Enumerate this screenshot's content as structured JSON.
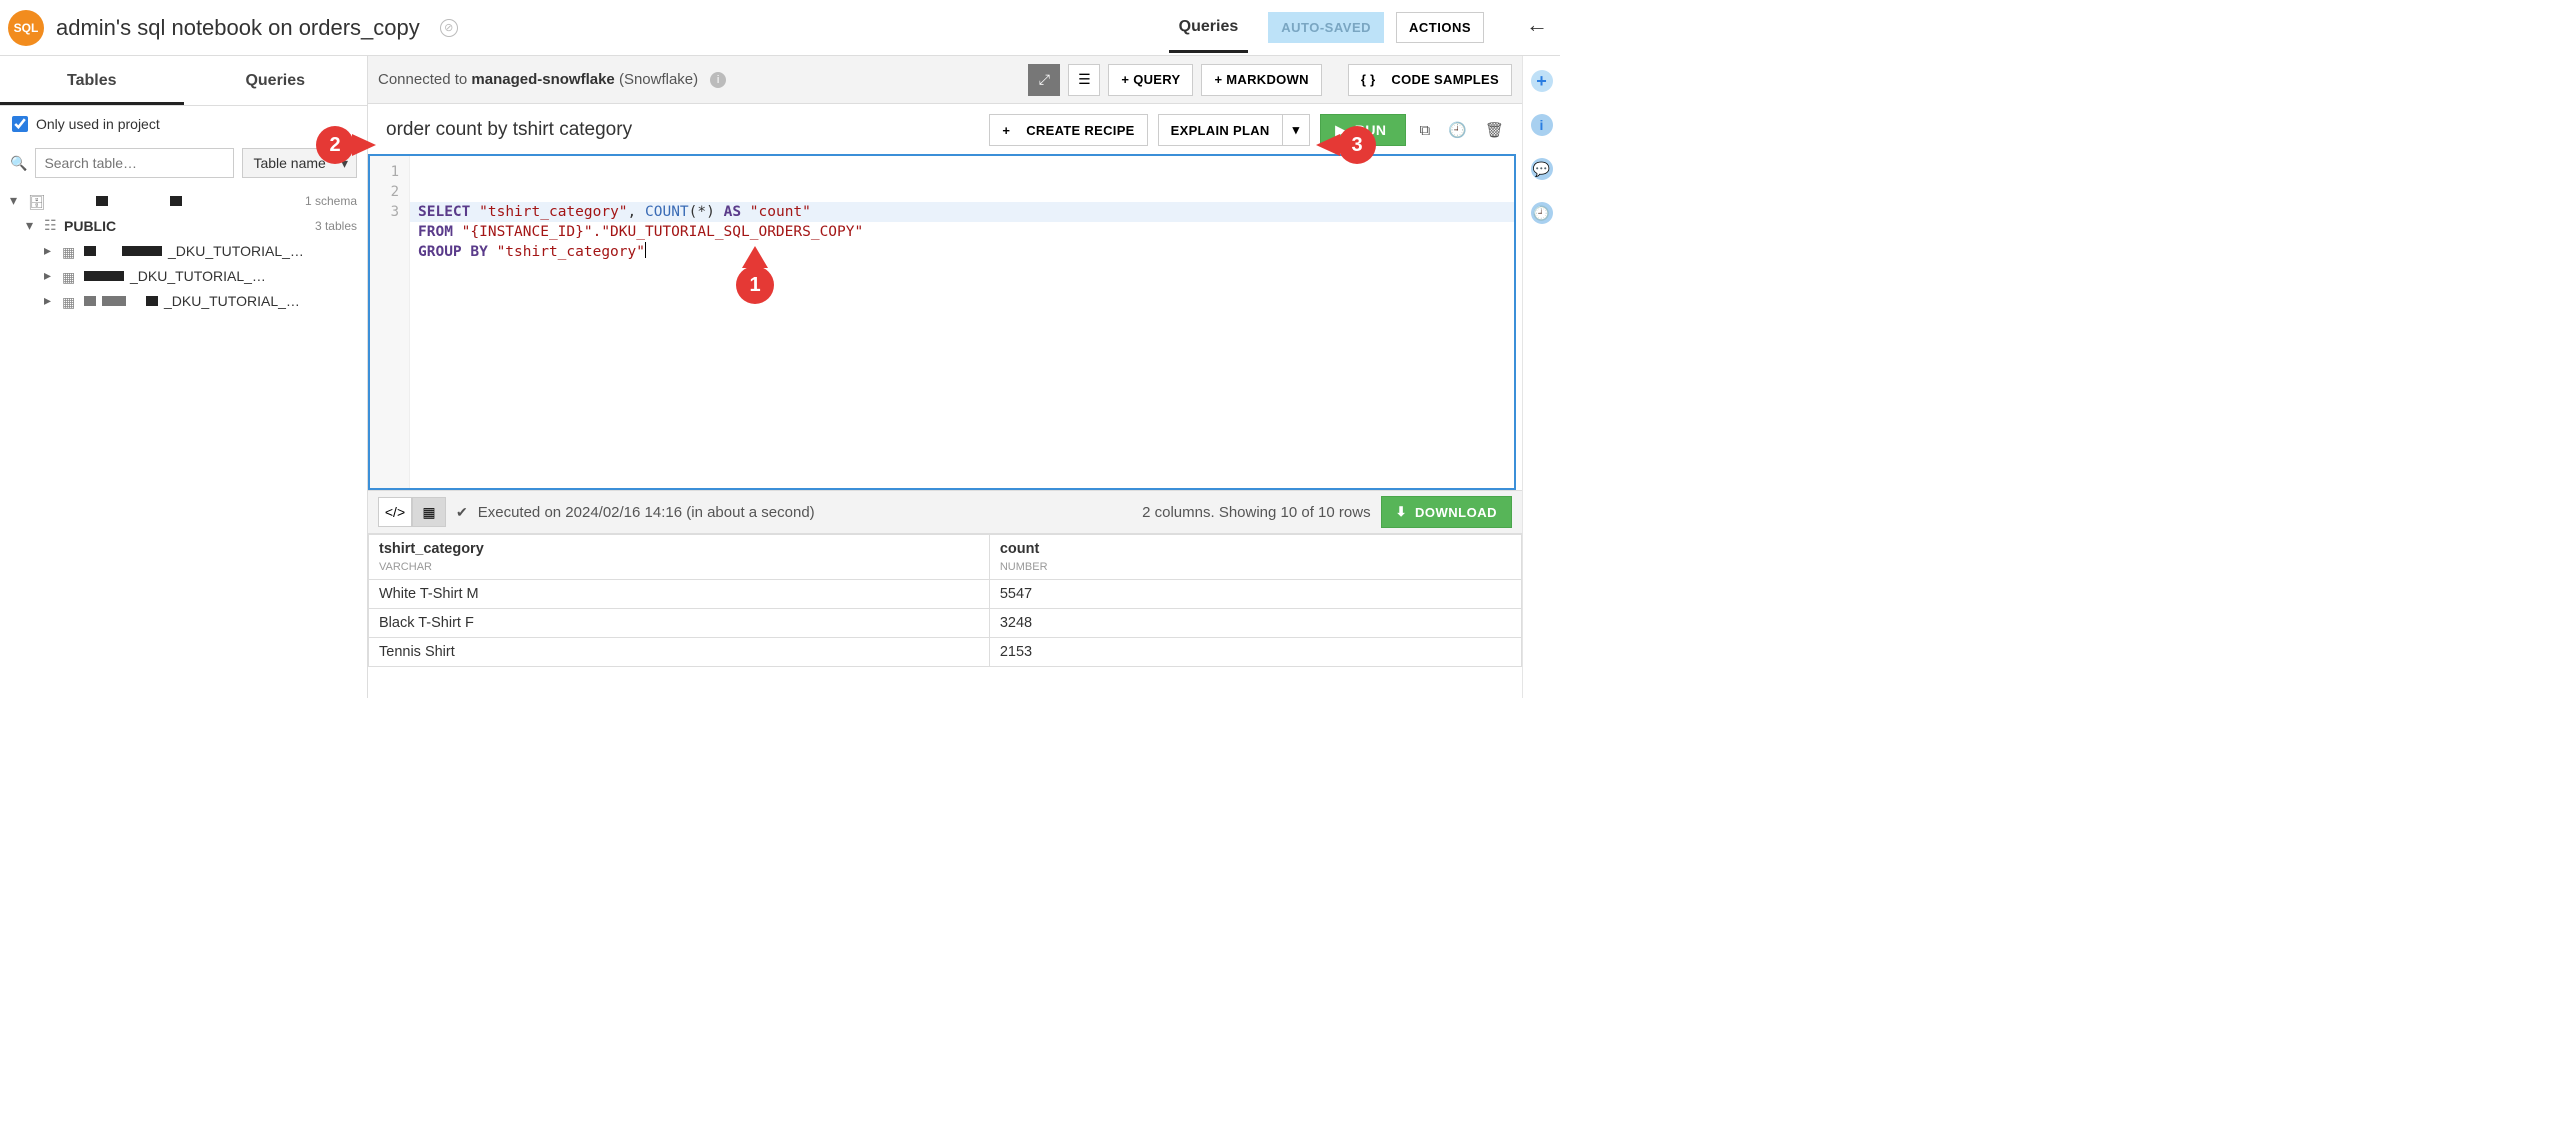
{
  "header": {
    "logo_text": "SQL",
    "title": "admin's sql notebook on orders_copy",
    "top_tab": "Queries",
    "autosaved": "AUTO-SAVED",
    "actions": "ACTIONS"
  },
  "left": {
    "tabs": {
      "tables": "Tables",
      "queries": "Queries"
    },
    "only_used_label": "Only used in project",
    "search_placeholder": "Search table…",
    "sort_label": "Table name",
    "schema_count": "1 schema",
    "schema_name": "PUBLIC",
    "table_count": "3 tables",
    "tables": [
      {
        "suffix": "_DKU_TUTORIAL_…"
      },
      {
        "suffix": "_DKU_TUTORIAL_…"
      },
      {
        "suffix": "_DKU_TUTORIAL_…"
      }
    ]
  },
  "conn": {
    "prefix": "Connected to ",
    "name": "managed-snowflake",
    "type": " (Snowflake)",
    "add_query": "+ QUERY",
    "add_markdown": "+ MARKDOWN",
    "code_samples": "CODE SAMPLES"
  },
  "query": {
    "title": "order count by tshirt category",
    "create_recipe": "CREATE RECIPE",
    "explain_plan": "EXPLAIN PLAN",
    "run": "RUN"
  },
  "sql": {
    "line1": {
      "select": "SELECT",
      "col1": "\"tshirt_category\"",
      "comma": ", ",
      "count": "COUNT",
      "paren_star": "(*)",
      "as": " AS ",
      "alias": "\"count\""
    },
    "line2": {
      "from": "FROM",
      "tbl": " \"{INSTANCE_ID}\".\"DKU_TUTORIAL_SQL_ORDERS_COPY\""
    },
    "line3": {
      "group_by": "GROUP BY",
      "col": " \"tshirt_category\""
    },
    "gutter": [
      "1",
      "2",
      "3"
    ]
  },
  "results": {
    "status": "Executed on 2024/02/16 14:16 (in about a second)",
    "summary": "2 columns. Showing 10 of 10 rows",
    "download": "DOWNLOAD",
    "columns": [
      {
        "name": "tshirt_category",
        "type": "VARCHAR"
      },
      {
        "name": "count",
        "type": "NUMBER"
      }
    ],
    "rows": [
      {
        "cat": "White T-Shirt M",
        "cnt": "5547"
      },
      {
        "cat": "Black T-Shirt F",
        "cnt": "3248"
      },
      {
        "cat": "Tennis Shirt",
        "cnt": "2153"
      }
    ]
  },
  "annotations": {
    "a1": "1",
    "a2": "2",
    "a3": "3"
  }
}
